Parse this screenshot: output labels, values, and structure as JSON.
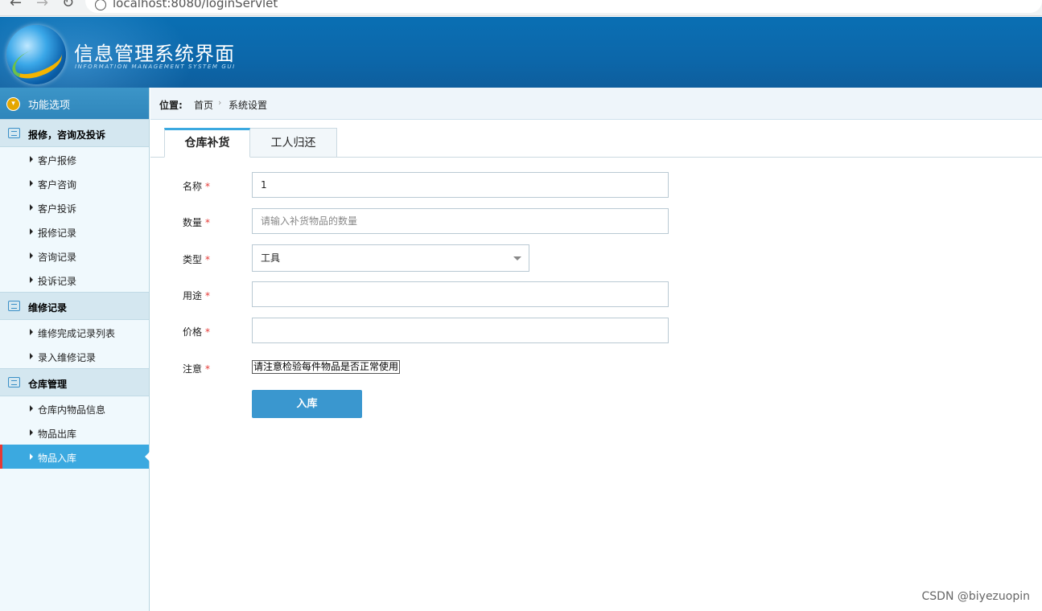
{
  "browser": {
    "url": "localhost:8080/loginServlet"
  },
  "header": {
    "title": "信息管理系统界面",
    "subtitle": "INFORMATION MANAGEMENT SYSTEM GUI"
  },
  "sidebar": {
    "top_label": "功能选项",
    "groups": [
      {
        "label": "报修，咨询及投诉",
        "icon": "list-icon",
        "items": [
          "客户报修",
          "客户咨询",
          "客户投诉",
          "报修记录",
          "咨询记录",
          "投诉记录"
        ]
      },
      {
        "label": "维修记录",
        "icon": "edit-icon",
        "items": [
          "维修完成记录列表",
          "录入维修记录"
        ]
      },
      {
        "label": "仓库管理",
        "icon": "chat-icon",
        "items": [
          "仓库内物品信息",
          "物品出库",
          "物品入库"
        ]
      }
    ],
    "active_item": "物品入库"
  },
  "breadcrumb": {
    "label": "位置:",
    "home": "首页",
    "separator": "›",
    "current": "系统设置"
  },
  "tabs": [
    "仓库补货",
    "工人归还"
  ],
  "form": {
    "name": {
      "label": "名称",
      "value": "1"
    },
    "quantity": {
      "label": "数量",
      "placeholder": "请输入补货物品的数量"
    },
    "type": {
      "label": "类型",
      "value": "工具"
    },
    "purpose": {
      "label": "用途",
      "value": ""
    },
    "price": {
      "label": "价格",
      "value": ""
    },
    "note": {
      "label": "注意",
      "text": "请注意检验每件物品是否正常使用"
    },
    "required_mark": "*",
    "submit_label": "入库"
  },
  "watermark": "CSDN @biyezuopin",
  "colors": {
    "header": "#0a6fb3",
    "accent": "#3ba9e0",
    "submit": "#3a97cf",
    "required": "#e53935"
  }
}
